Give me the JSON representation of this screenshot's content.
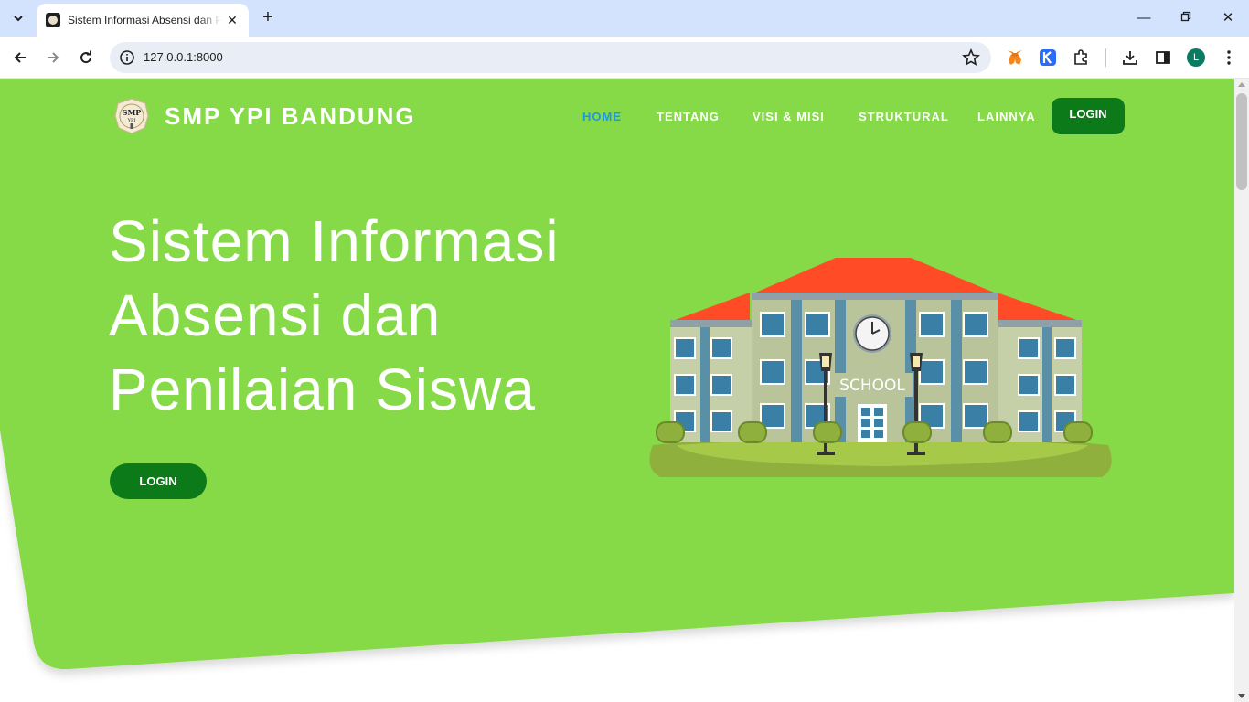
{
  "browser": {
    "tab_title": "Sistem Informasi Absensi dan Penilaian Siswa",
    "url": "127.0.0.1:8000",
    "profile_initial": "L"
  },
  "navbar": {
    "brand": "SMP YPI BANDUNG",
    "logo_text": "SMP",
    "logo_subtext": "YPI",
    "items": [
      {
        "label": "HOME",
        "active": true
      },
      {
        "label": "TENTANG",
        "active": false
      },
      {
        "label": "VISI & MISI",
        "active": false
      },
      {
        "label": "STRUKTURAL",
        "active": false
      },
      {
        "label": "LAINNYA",
        "active": false
      }
    ],
    "login_label": "LOGIN"
  },
  "hero": {
    "title_lines": [
      "Sistem Informasi",
      "Absensi dan",
      "Penilaian Siswa"
    ],
    "login_label": "LOGIN",
    "illustration_sign": "SCHOOL"
  },
  "colors": {
    "hero_green": "#86d946",
    "button_green": "#0d7a1a",
    "active_nav": "#1a9be0",
    "roof": "#ff4b26"
  }
}
